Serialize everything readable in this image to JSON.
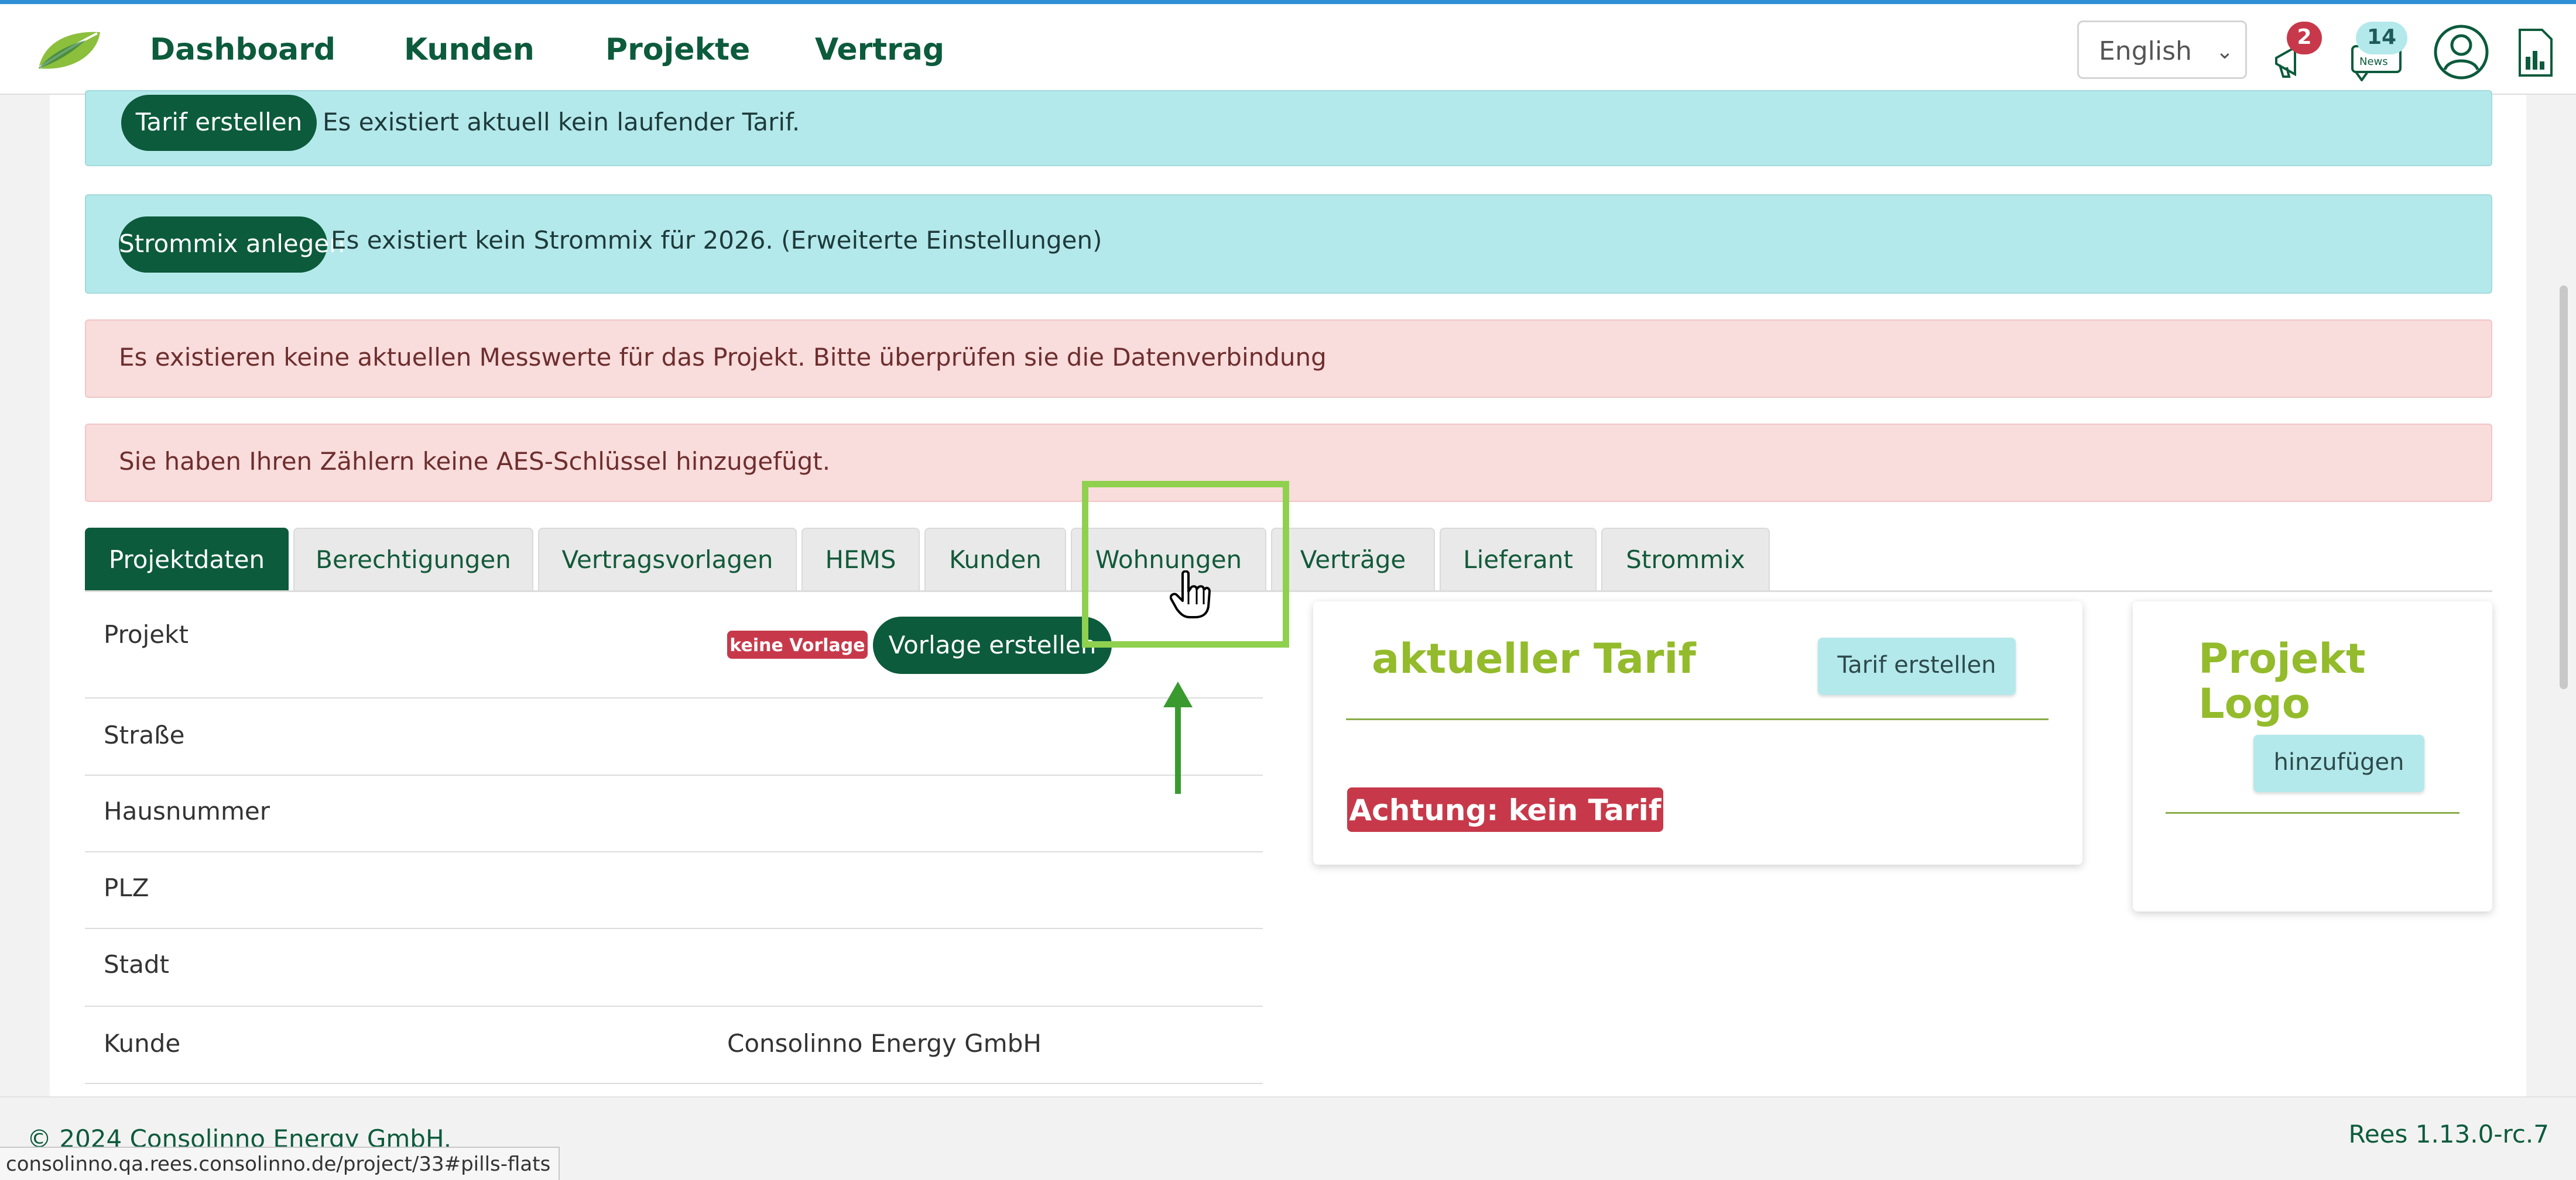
{
  "nav": {
    "links": [
      "Dashboard",
      "Kunden",
      "Projekte",
      "Vertrag"
    ],
    "language": "English",
    "notification_count": "2",
    "news_count": "14"
  },
  "alerts": {
    "tarif_button": "Tarif erstellen",
    "tarif_text": "Es existiert aktuell kein laufender Tarif.",
    "strommix_button": "Strommix anlegen",
    "strommix_text": "Es existiert kein Strommix für 2026. (Erweiterte Einstellungen)",
    "messwerte_text": "Es existieren keine aktuellen Messwerte für das Projekt. Bitte überprüfen sie die Datenverbindung",
    "aes_text": "Sie haben Ihren Zählern keine AES-Schlüssel hinzugefügt."
  },
  "tabs": [
    "Projektdaten",
    "Berechtigungen",
    "Vertragsvorlagen",
    "HEMS",
    "Kunden",
    "Wohnungen",
    "Verträge",
    "Lieferant",
    "Strommix"
  ],
  "project_table": {
    "rows": [
      {
        "label": "Projekt",
        "value": ""
      },
      {
        "label": "Straße",
        "value": ""
      },
      {
        "label": "Hausnummer",
        "value": ""
      },
      {
        "label": "PLZ",
        "value": ""
      },
      {
        "label": "Stadt",
        "value": ""
      },
      {
        "label": "Kunde",
        "value": "Consolinno Energy GmbH"
      }
    ],
    "vorlage_badge": "keine Vorlage",
    "vorlage_button": "Vorlage erstellen"
  },
  "tarif_card": {
    "title": "aktueller Tarif",
    "button": "Tarif erstellen",
    "warning": "Achtung: kein Tarif"
  },
  "logo_card": {
    "title": "Projekt Logo",
    "button": "hinzufügen"
  },
  "footer": {
    "copyright": "© 2024 Consolinno Energy GmbH.",
    "version": "Rees 1.13.0-rc.7"
  },
  "status_url": "consolinno.qa.rees.consolinno.de/project/33#pills-flats",
  "colors": {
    "brand_green": "#0c5b3c",
    "accent_lime": "#93bb2b",
    "info_bg": "#b4e9eb",
    "danger_bg": "#f9dcdc",
    "danger_tag": "#c7394a",
    "highlight": "#8fd14f"
  },
  "icons": [
    "leaf-logo-icon",
    "notification-bell-icon",
    "news-icon",
    "user-avatar-icon",
    "document-icon",
    "hand-cursor-icon",
    "arrow-up-icon"
  ]
}
